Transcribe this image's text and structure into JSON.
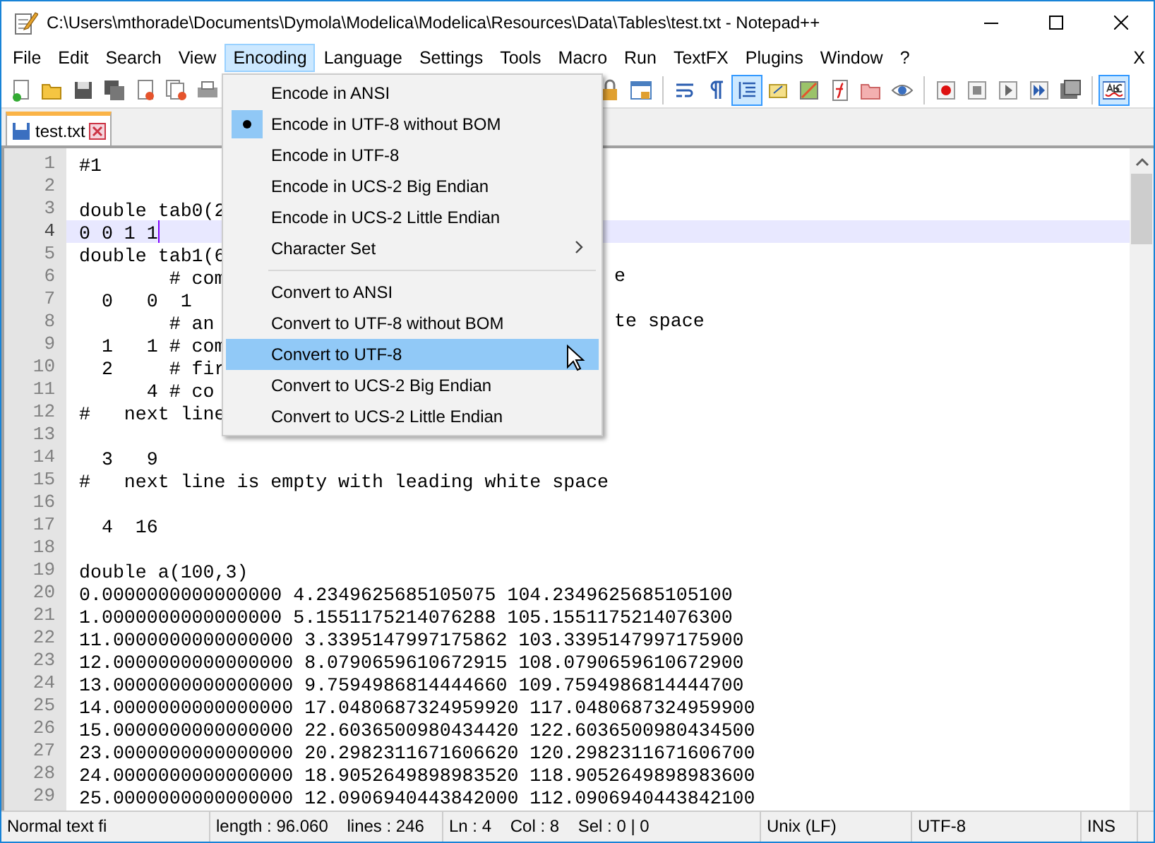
{
  "window": {
    "title": "C:\\Users\\mthorade\\Documents\\Dymola\\Modelica\\Modelica\\Resources\\Data\\Tables\\test.txt - Notepad++"
  },
  "menu_bar": [
    {
      "label": "File",
      "selected": false
    },
    {
      "label": "Edit",
      "selected": false
    },
    {
      "label": "Search",
      "selected": false
    },
    {
      "label": "View",
      "selected": false
    },
    {
      "label": "Encoding",
      "selected": true
    },
    {
      "label": "Language",
      "selected": false
    },
    {
      "label": "Settings",
      "selected": false
    },
    {
      "label": "Tools",
      "selected": false
    },
    {
      "label": "Macro",
      "selected": false
    },
    {
      "label": "Run",
      "selected": false
    },
    {
      "label": "TextFX",
      "selected": false
    },
    {
      "label": "Plugins",
      "selected": false
    },
    {
      "label": "Window",
      "selected": false
    },
    {
      "label": "?",
      "selected": false
    }
  ],
  "close_document": "X",
  "toolbar": [
    {
      "pressed": false
    },
    {
      "pressed": false
    },
    {
      "pressed": false
    },
    {
      "pressed": false
    },
    {
      "pressed": false
    },
    {
      "pressed": false
    },
    {
      "pressed": false
    },
    {
      "pressed": false
    },
    {
      "pressed": false
    },
    {
      "pressed": false
    },
    {
      "pressed": false
    },
    {
      "pressed": true
    },
    {
      "pressed": false
    },
    {
      "pressed": false
    },
    {
      "pressed": false
    },
    {
      "pressed": false
    },
    {
      "pressed": false
    },
    {
      "pressed": false
    },
    {
      "pressed": false
    },
    {
      "pressed": false
    },
    {
      "pressed": false
    },
    {
      "pressed": false
    },
    {
      "pressed": true
    }
  ],
  "tabs": [
    {
      "label": "test.txt",
      "selected": true
    }
  ],
  "editor": {
    "lines": [
      {
        "number": "1",
        "text": "#1",
        "current": false
      },
      {
        "number": "2",
        "current": false
      },
      {
        "number": "3",
        "text": "double tab0(2",
        "current": false
      },
      {
        "number": "4",
        "text": "0 0 1 1",
        "current": true
      },
      {
        "number": "5",
        "text": "double tab1(6",
        "current": false
      },
      {
        "number": "6",
        "text": "        # com",
        "current": false,
        "right_text": "e"
      },
      {
        "number": "7",
        "text": "  0   0  1",
        "current": false
      },
      {
        "number": "8",
        "text": "        # an",
        "current": false,
        "right_text": "te space"
      },
      {
        "number": "9",
        "text": "  1   1 # com",
        "current": false
      },
      {
        "number": "10",
        "text": "  2     # fir",
        "current": false
      },
      {
        "number": "11",
        "text": "      4 # co",
        "current": false
      },
      {
        "number": "12",
        "text": "#   next line",
        "current": false
      },
      {
        "number": "13",
        "current": false
      },
      {
        "number": "14",
        "text": "  3   9",
        "current": false
      },
      {
        "number": "15",
        "text": "#   next line is empty with leading white space",
        "current": false
      },
      {
        "number": "16",
        "current": false
      },
      {
        "number": "17",
        "text": "  4  16",
        "current": false
      },
      {
        "number": "18",
        "current": false
      },
      {
        "number": "19",
        "text": "double a(100,3)",
        "current": false
      },
      {
        "number": "20",
        "text": "0.0000000000000000 4.2349625685105075 104.2349625685105100",
        "current": false
      },
      {
        "number": "21",
        "text": "1.0000000000000000 5.1551175214076288 105.1551175214076300",
        "current": false
      },
      {
        "number": "22",
        "text": "11.0000000000000000 3.3395147997175862 103.3395147997175900",
        "current": false
      },
      {
        "number": "23",
        "text": "12.0000000000000000 8.0790659610672915 108.0790659610672900",
        "current": false
      },
      {
        "number": "24",
        "text": "13.0000000000000000 9.7594986814444660 109.7594986814444700",
        "current": false
      },
      {
        "number": "25",
        "text": "14.0000000000000000 17.0480687324959920 117.0480687324959900",
        "current": false
      },
      {
        "number": "26",
        "text": "15.0000000000000000 22.6036500980434420 122.6036500980434500",
        "current": false
      },
      {
        "number": "27",
        "text": "23.0000000000000000 20.2982311671606620 120.2982311671606700",
        "current": false
      },
      {
        "number": "28",
        "text": "24.0000000000000000 18.9052649898983520 118.9052649898983600",
        "current": false
      },
      {
        "number": "29",
        "text": "25.0000000000000000 12.0906940443842000 112.0906940443842100",
        "current": false
      }
    ]
  },
  "encoding_menu": {
    "items": [
      {
        "kind": "item",
        "label": "Encode in ANSI",
        "checked": false,
        "highlighted": false
      },
      {
        "kind": "item",
        "label": "Encode in UTF-8 without BOM",
        "checked": true,
        "highlighted": false
      },
      {
        "kind": "item",
        "label": "Encode in UTF-8",
        "checked": false,
        "highlighted": false
      },
      {
        "kind": "item",
        "label": "Encode in UCS-2 Big Endian",
        "checked": false,
        "highlighted": false
      },
      {
        "kind": "item",
        "label": "Encode in UCS-2 Little Endian",
        "checked": false,
        "highlighted": false
      },
      {
        "kind": "submenu",
        "label": "Character Set",
        "checked": false,
        "highlighted": false
      },
      {
        "kind": "separator"
      },
      {
        "kind": "item",
        "label": "Convert to ANSI",
        "checked": false,
        "highlighted": false
      },
      {
        "kind": "item",
        "label": "Convert to UTF-8 without BOM",
        "checked": false,
        "highlighted": false
      },
      {
        "kind": "item",
        "label": "Convert to UTF-8",
        "checked": false,
        "highlighted": true
      },
      {
        "kind": "item",
        "label": "Convert to UCS-2 Big Endian",
        "checked": false,
        "highlighted": false
      },
      {
        "kind": "item",
        "label": "Convert to UCS-2 Little Endian",
        "checked": false,
        "highlighted": false
      }
    ]
  },
  "status_bar": [
    "Normal text fi",
    "length : 96.060    lines : 246",
    "Ln : 4    Col : 8    Sel : 0 | 0",
    "Unix (LF)",
    "UTF-8",
    "INS"
  ]
}
